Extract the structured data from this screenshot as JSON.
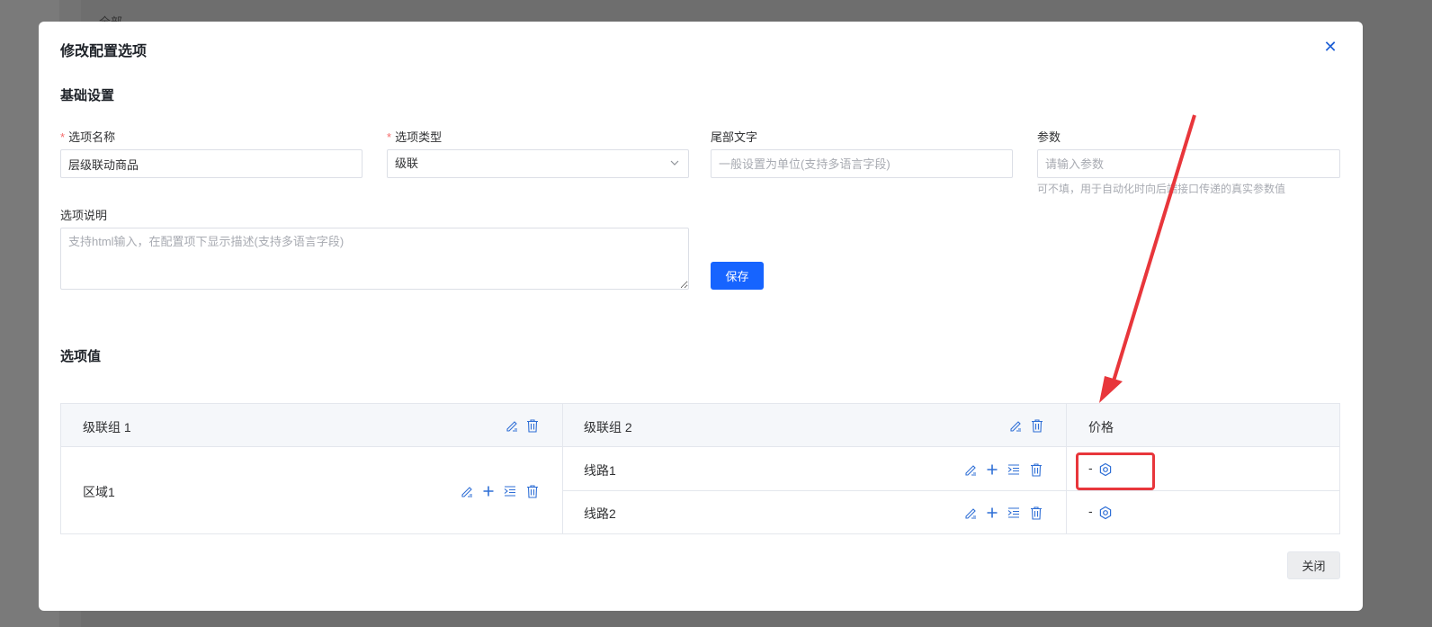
{
  "background": {
    "tab_label": "全部"
  },
  "modal": {
    "title": "修改配置选项",
    "close_icon": "close-icon"
  },
  "basic": {
    "section_title": "基础设置",
    "name": {
      "label": "选项名称",
      "required": true,
      "value": "层级联动商品"
    },
    "type": {
      "label": "选项类型",
      "required": true,
      "value": "级联"
    },
    "suffix": {
      "label": "尾部文字",
      "placeholder": "一般设置为单位(支持多语言字段)"
    },
    "param": {
      "label": "参数",
      "placeholder": "请输入参数",
      "hint": "可不填，用于自动化时向后端接口传递的真实参数值"
    },
    "desc": {
      "label": "选项说明",
      "placeholder": "支持html输入，在配置项下显示描述(支持多语言字段)"
    },
    "save_label": "保存"
  },
  "values": {
    "section_title": "选项值",
    "headers": {
      "group1": "级联组 1",
      "group2": "级联组 2",
      "price": "价格"
    },
    "group1_row": {
      "label": "区域1"
    },
    "rows": [
      {
        "label": "线路1",
        "price": "-"
      },
      {
        "label": "线路2",
        "price": "-"
      }
    ]
  },
  "footer": {
    "close_label": "关闭"
  },
  "colors": {
    "primary": "#1664ff",
    "icon": "#2f6fd6",
    "annotation": "#e8363b"
  }
}
